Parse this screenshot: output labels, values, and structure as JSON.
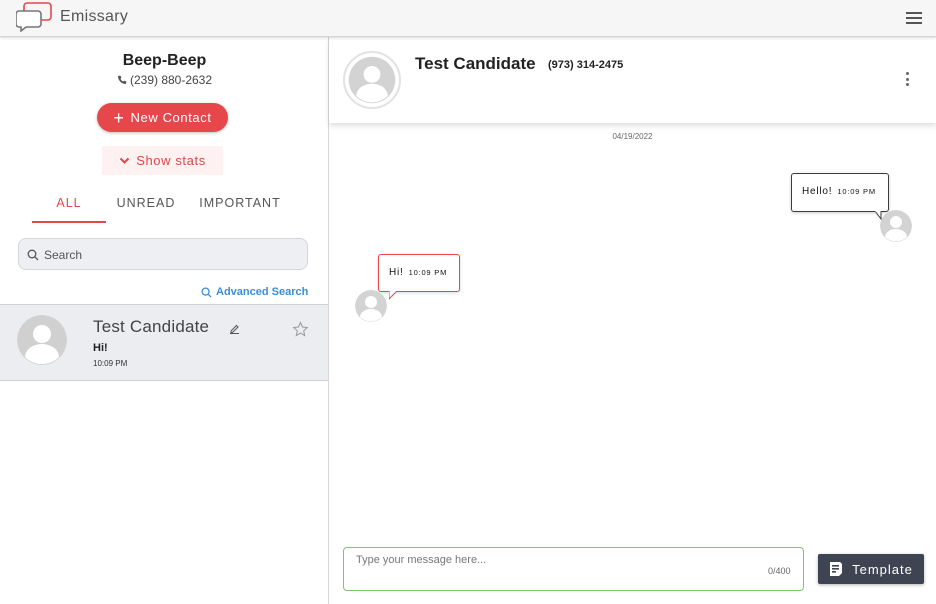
{
  "app": {
    "brand": "Emissary",
    "accent_color": "#e5474b",
    "brand_icon": "chat-bubbles-logo",
    "menu_icon": "hamburger-menu-icon"
  },
  "sidebar": {
    "account_name": "Beep-Beep",
    "account_phone": "(239) 880-2632",
    "new_contact_label": "New Contact",
    "show_stats_label": "Show stats",
    "tabs": [
      {
        "label": "ALL",
        "active": true
      },
      {
        "label": "UNREAD",
        "active": false
      },
      {
        "label": "IMPORTANT",
        "active": false
      }
    ],
    "search_placeholder": "Search",
    "search_value": "",
    "advanced_search_label": "Advanced Search",
    "contacts": [
      {
        "name": "Test Candidate",
        "last_message": "Hi!",
        "time": "10:09 PM",
        "starred": false,
        "selected": true
      }
    ]
  },
  "chat": {
    "contact_name": "Test Candidate",
    "contact_phone": "(973) 314-2475",
    "date_separator": "04/19/2022",
    "messages": [
      {
        "direction": "outgoing",
        "text": "Hello!",
        "time": "10:09 PM"
      },
      {
        "direction": "incoming",
        "text": "Hi!",
        "time": "10:09 PM"
      }
    ],
    "composer_placeholder": "Type your message here...",
    "composer_value": "",
    "char_count": "0/400",
    "template_label": "Template",
    "composer_border_color": "#7cc767"
  }
}
